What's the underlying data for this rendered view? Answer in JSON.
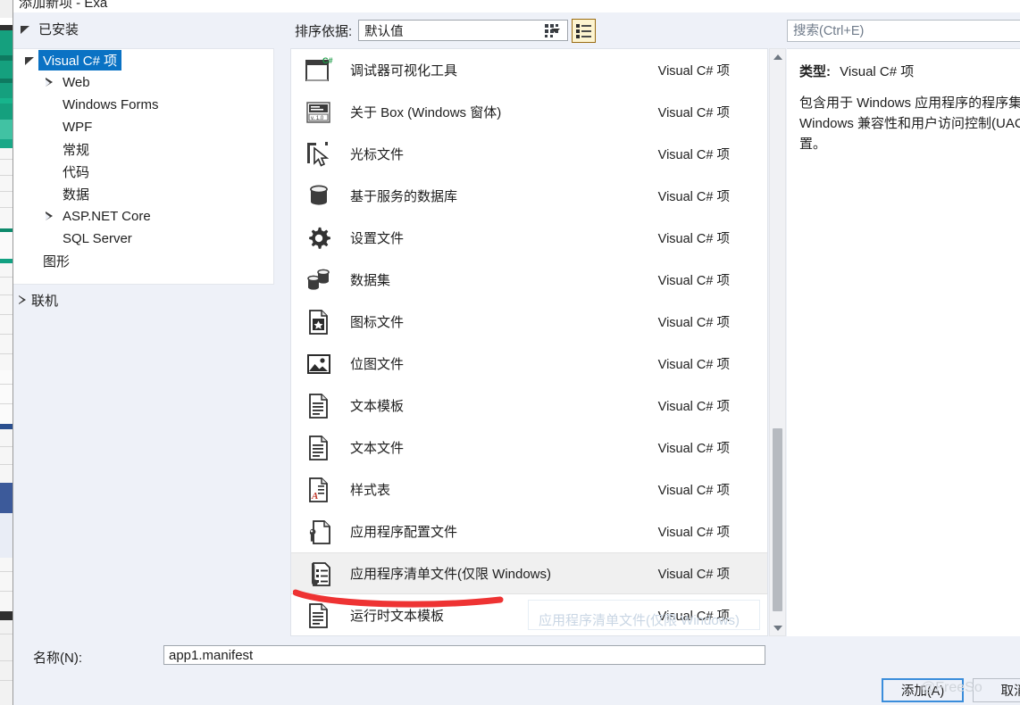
{
  "window": {
    "title": "添加新项 - Exa"
  },
  "header": {
    "installed_label": "已安装",
    "online_label": "联机",
    "sort_label": "排序依据:",
    "sort_value": "默认值",
    "view_tiles_name": "tiles-view",
    "view_list_name": "list-view"
  },
  "search": {
    "placeholder": "搜索(Ctrl+E)",
    "value": ""
  },
  "tree": {
    "items": [
      {
        "label": "Visual C# 项",
        "indent": 0,
        "expander": "down",
        "selected": true
      },
      {
        "label": "Web",
        "indent": 1,
        "expander": "right",
        "selected": false
      },
      {
        "label": "Windows Forms",
        "indent": 1,
        "expander": "none",
        "selected": false
      },
      {
        "label": "WPF",
        "indent": 1,
        "expander": "none",
        "selected": false
      },
      {
        "label": "常规",
        "indent": 1,
        "expander": "none",
        "selected": false
      },
      {
        "label": "代码",
        "indent": 1,
        "expander": "none",
        "selected": false
      },
      {
        "label": "数据",
        "indent": 1,
        "expander": "none",
        "selected": false
      },
      {
        "label": "ASP.NET Core",
        "indent": 1,
        "expander": "right",
        "selected": false
      },
      {
        "label": "SQL Server",
        "indent": 1,
        "expander": "none",
        "selected": false
      },
      {
        "label": "图形",
        "indent": 0,
        "expander": "none",
        "selected": false
      }
    ]
  },
  "list": {
    "kind_text": "Visual C# 项",
    "items": [
      {
        "name": "调试器可视化工具",
        "kind": "Visual C# 项",
        "icon": "csharp-window-icon",
        "selected": false
      },
      {
        "name": "关于 Box (Windows 窗体)",
        "kind": "Visual C# 项",
        "icon": "about-box-icon",
        "selected": false
      },
      {
        "name": "光标文件",
        "kind": "Visual C# 项",
        "icon": "cursor-icon",
        "selected": false
      },
      {
        "name": "基于服务的数据库",
        "kind": "Visual C# 项",
        "icon": "database-icon",
        "selected": false
      },
      {
        "name": "设置文件",
        "kind": "Visual C# 项",
        "icon": "gear-icon",
        "selected": false
      },
      {
        "name": "数据集",
        "kind": "Visual C# 项",
        "icon": "dataset-icon",
        "selected": false
      },
      {
        "name": "图标文件",
        "kind": "Visual C# 项",
        "icon": "icon-file-icon",
        "selected": false
      },
      {
        "name": "位图文件",
        "kind": "Visual C# 项",
        "icon": "bitmap-icon",
        "selected": false
      },
      {
        "name": "文本模板",
        "kind": "Visual C# 项",
        "icon": "text-document-icon",
        "selected": false
      },
      {
        "name": "文本文件",
        "kind": "Visual C# 项",
        "icon": "text-document-icon",
        "selected": false
      },
      {
        "name": "样式表",
        "kind": "Visual C# 项",
        "icon": "stylesheet-icon",
        "selected": false
      },
      {
        "name": "应用程序配置文件",
        "kind": "Visual C# 项",
        "icon": "app-config-icon",
        "selected": false
      },
      {
        "name": "应用程序清单文件(仅限 Windows)",
        "kind": "Visual C# 项",
        "icon": "app-manifest-icon",
        "selected": true
      },
      {
        "name": "运行时文本模板",
        "kind": "Visual C# 项",
        "icon": "text-document-icon",
        "selected": false
      }
    ]
  },
  "detail": {
    "type_label": "类型:",
    "type_value": "Visual C# 项",
    "description": "包含用于 Windows 应用程序的程序集绑定、Windows 兼容性和用户访问控制(UAC)的设置。"
  },
  "footer": {
    "name_label": "名称(N):",
    "name_value": "app1.manifest",
    "add_button": "添加(A)",
    "cancel_button": "取消"
  },
  "annotation": {
    "tooltip_ghost": "应用程序清单文件(仅限 Windows)",
    "watermark": "@FreeSo",
    "highlight_color": "#ee3333"
  }
}
